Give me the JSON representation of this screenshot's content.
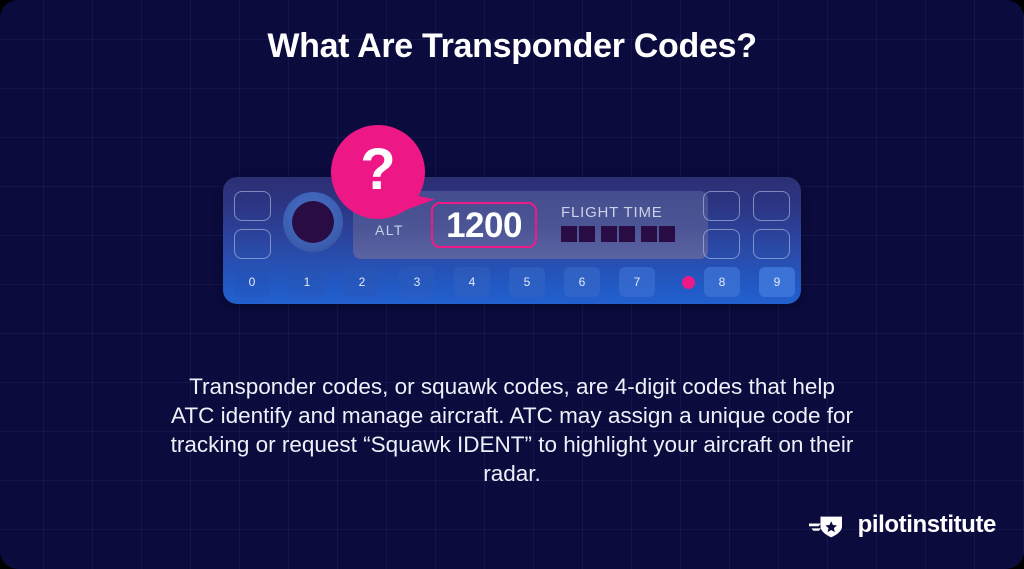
{
  "slide": {
    "title": "What Are Transponder Codes?",
    "background_color": "#0b0b3d",
    "grid_line_color": "#7882dc",
    "accent_color": "#ed1785",
    "body_text": "Transponder codes, or squawk codes, are 4-digit codes that help ATC identify and manage aircraft. ATC may assign a unique code for tracking or request “Squawk IDENT” to highlight your aircraft on their radar."
  },
  "callout": {
    "icon": "question-mark-speech-bubble",
    "symbol": "?",
    "color": "#ed1785"
  },
  "transponder": {
    "panel_gradient_top": "#2b2f73",
    "panel_gradient_bottom": "#2260cf",
    "knob": {
      "icon": "rotary-knob",
      "outer_color": "#3d62b6",
      "inner_color": "#2a0c44"
    },
    "left_buttons": [
      {
        "name": "function-button-1",
        "label": ""
      },
      {
        "name": "function-button-2",
        "label": ""
      }
    ],
    "right_buttons": [
      {
        "name": "mode-button-1",
        "label": ""
      },
      {
        "name": "mode-button-2",
        "label": ""
      },
      {
        "name": "mode-button-3",
        "label": ""
      },
      {
        "name": "mode-button-4",
        "label": ""
      }
    ],
    "display": {
      "mode_label": "ALT",
      "squawk_code": "1200",
      "code_highlight_color": "#ef1a86",
      "flight_time_label": "FLIGHT TIME",
      "flight_time_segments": 6,
      "segment_color": "#2a0c44"
    },
    "keypad": {
      "keys": [
        "0",
        "1",
        "2",
        "3",
        "4",
        "5",
        "6",
        "7",
        "8",
        "9"
      ],
      "cursor_indicator": {
        "name": "pink-cursor-dot",
        "color": "#ec1a85",
        "after_key": "7"
      }
    }
  },
  "logo": {
    "mark": "winged-shield-star-icon",
    "text": "pilotinstitute"
  }
}
